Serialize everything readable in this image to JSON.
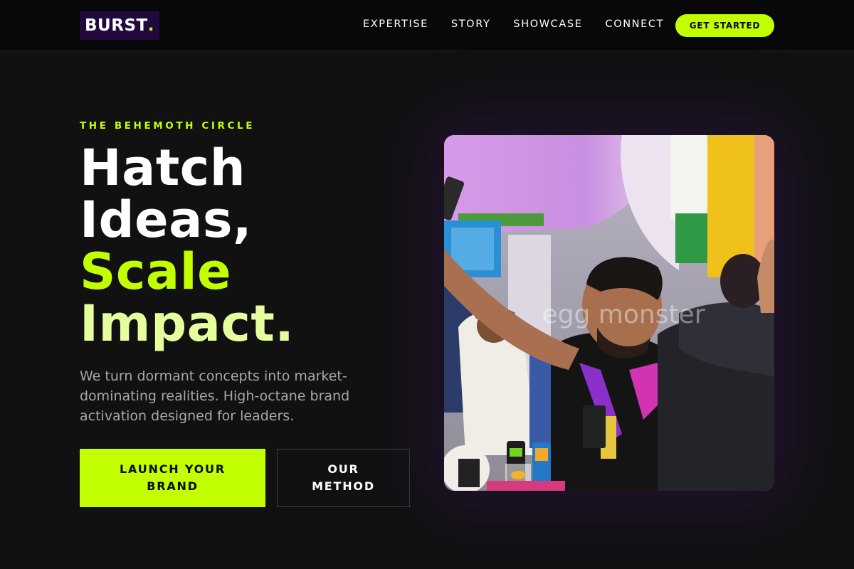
{
  "brand": {
    "name": "BURST",
    "dot": "."
  },
  "nav": {
    "links": [
      "EXPERTISE",
      "STORY",
      "SHOWCASE",
      "CONNECT"
    ],
    "cta_label": "GET STARTED"
  },
  "hero": {
    "eyebrow": "THE BEHEMOTH CIRCLE",
    "headline": {
      "line1": "Hatch",
      "line2": "Ideas,",
      "line3": "Scale",
      "line4": "Impact."
    },
    "lead": "We turn dormant concepts into market-dominating realities. High-octane brand activation designed for leaders.",
    "primary_button": "LAUNCH YOUR BRAND",
    "secondary_button": "OUR METHOD",
    "image": {
      "watermark": "egg monster"
    }
  },
  "colors": {
    "accent": "#c2ff00",
    "accent_soft": "#e6ff9e",
    "background": "#111111",
    "nav_bg": "#080808",
    "logo_bg": "#22093d"
  }
}
